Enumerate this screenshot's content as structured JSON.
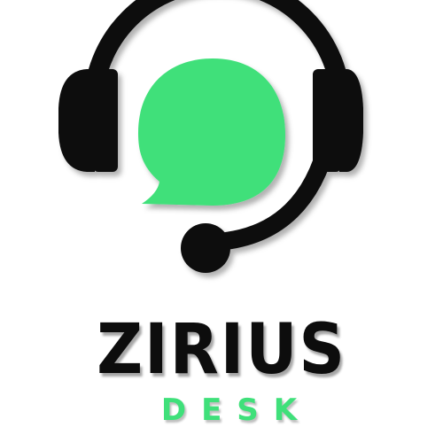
{
  "logo": {
    "name_primary": "ZIRIUS",
    "name_secondary": "DESK",
    "icon": "headset-chat-bubble-icon",
    "colors": {
      "ink": "#0d0d0d",
      "accent": "#3fe07a",
      "background": "#ffffff"
    }
  }
}
